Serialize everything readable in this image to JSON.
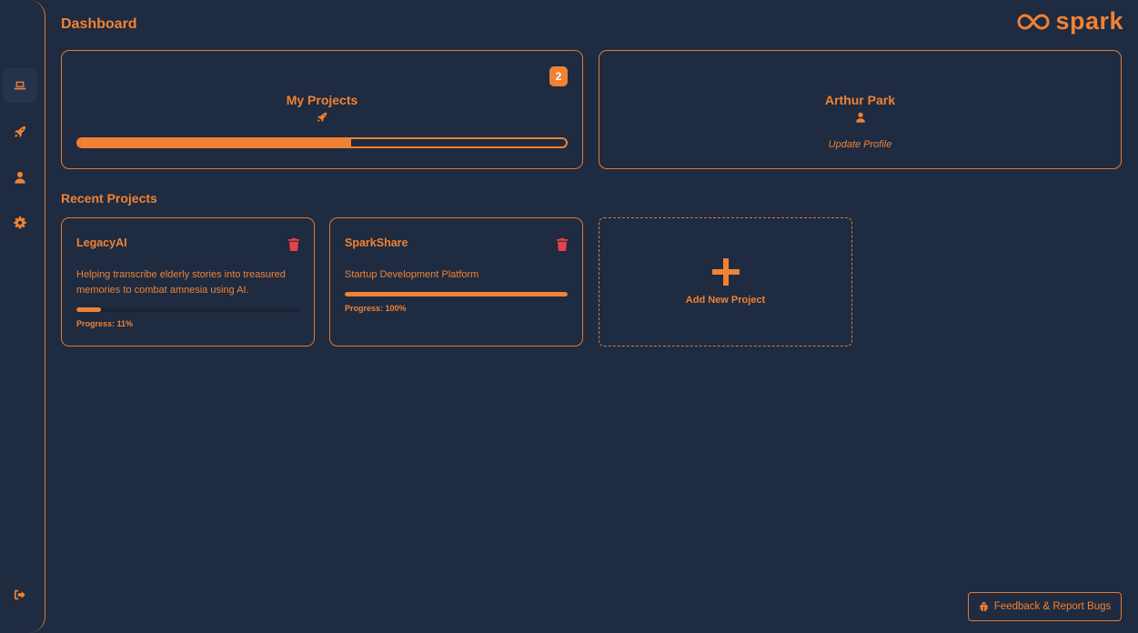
{
  "colors": {
    "accent": "#f08235",
    "background": "#1e2b40",
    "danger": "#e8404a"
  },
  "header": {
    "title": "Dashboard",
    "logo_text": "spark"
  },
  "sidebar": {
    "items": [
      {
        "name": "dashboard",
        "icon": "laptop-icon",
        "active": true
      },
      {
        "name": "projects",
        "icon": "rocket-icon",
        "active": false
      },
      {
        "name": "profile",
        "icon": "user-icon",
        "active": false
      },
      {
        "name": "settings",
        "icon": "gear-icon",
        "active": false
      }
    ],
    "logout_icon": "logout-icon"
  },
  "my_projects": {
    "title": "My Projects",
    "icon": "rocket-icon",
    "count": "2",
    "progress": 0.56
  },
  "profile": {
    "name": "Arthur Park",
    "icon": "user-icon",
    "update_link": "Update Profile"
  },
  "recent": {
    "title": "Recent Projects",
    "projects": [
      {
        "name": "LegacyAI",
        "description": "Helping transcribe elderly stories into treasured memories to combat amnesia using AI.",
        "progress": 11,
        "progress_label": "Progress: 11%"
      },
      {
        "name": "SparkShare",
        "description": "Startup Development Platform",
        "progress": 100,
        "progress_label": "Progress: 100%"
      }
    ],
    "add_label": "Add New Project"
  },
  "feedback_button": "Feedback & Report Bugs"
}
